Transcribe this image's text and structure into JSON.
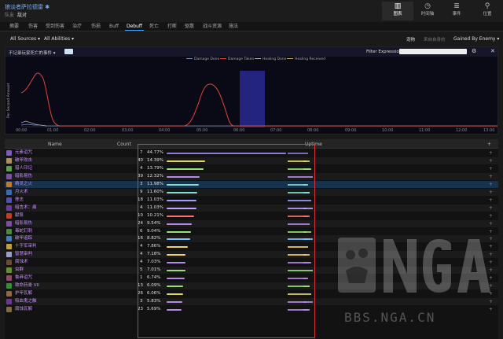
{
  "header": {
    "title": "狼淡者萨拉德雷",
    "title_icon": "✱",
    "subtitle_label": "队友",
    "subtitle_value": "敌对",
    "nav": [
      {
        "icon": "▥",
        "label": "图表"
      },
      {
        "icon": "◷",
        "label": "时间轴"
      },
      {
        "icon": "≣",
        "label": "事件"
      },
      {
        "icon": "⚲",
        "label": "位置"
      }
    ]
  },
  "tabs": [
    "摘要",
    "伤害",
    "受到伤害",
    "治疗",
    "伤损",
    "Buff",
    "Debuff",
    "死亡",
    "打断",
    "驱散",
    "战斗资源",
    "施法"
  ],
  "active_tab": "Debuff",
  "filters": {
    "sources": "All Sources ▾",
    "abilities": "All Abilities ▾",
    "right1": "宠物",
    "right2": "来自自身的",
    "gained_by": "Gained By Enemy ▾"
  },
  "chart": {
    "events_label": "不记录玩家死亡的事件 ▾",
    "filter_label": "Filter Expression",
    "filter_placeholder": "",
    "gear_icon": "⚙",
    "close_icon": "✕",
    "legend": [
      {
        "name": "Damage Done",
        "color": "#7d8cc4"
      },
      {
        "name": "Damage Taken",
        "color": "#e0453a"
      },
      {
        "name": "Healing Done",
        "color": "#b0b0b0"
      },
      {
        "name": "Healing Received",
        "color": "#c0a060"
      }
    ],
    "ylabel": "Per Second Amount",
    "xticks": [
      "00:00",
      "01:00",
      "02:00",
      "03:00",
      "04:00",
      "05:00",
      "06:00",
      "07:00",
      "08:00",
      "09:00",
      "10:00",
      "11:00",
      "12:00",
      "13:00"
    ]
  },
  "table": {
    "headers": {
      "name": "Name",
      "count": "Count",
      "uptime": "Uptime",
      "plus": "+"
    },
    "rows": [
      {
        "name": "元素诅咒",
        "count": "7",
        "pct": "44.77%",
        "uptime": 0.4477,
        "color": "#8e7dd6",
        "icon": "#7d5bbf"
      },
      {
        "name": "破甲攻击",
        "count": "40",
        "pct": "14.39%",
        "uptime": 0.1439,
        "color": "#e6d36a",
        "icon": "#b0905a"
      },
      {
        "name": "猎人印记",
        "count": "4",
        "pct": "13.79%",
        "uptime": 0.1379,
        "color": "#9adf7a",
        "icon": "#5aa04a"
      },
      {
        "name": "暗影易伤",
        "count": "39",
        "pct": "12.32%",
        "uptime": 0.1232,
        "color": "#b48ae6",
        "icon": "#7a50a0"
      },
      {
        "name": "精灵之火",
        "count": "3",
        "pct": "11.98%",
        "uptime": 0.1198,
        "color": "#7fe0d0",
        "icon": "#c07a30"
      },
      {
        "name": "月火术",
        "count": "9",
        "pct": "11.60%",
        "uptime": 0.116,
        "color": "#7fe0d0",
        "icon": "#3a6ab0"
      },
      {
        "name": "挫志",
        "count": "18",
        "pct": "11.03%",
        "uptime": 0.1103,
        "color": "#a0a0ff",
        "icon": "#5050b0"
      },
      {
        "name": "暗言术：痛",
        "count": "4",
        "pct": "11.03%",
        "uptime": 0.1103,
        "color": "#c8a0ff",
        "icon": "#6a3a9a"
      },
      {
        "name": "献祭",
        "count": "10",
        "pct": "10.21%",
        "uptime": 0.1021,
        "color": "#ff7070",
        "icon": "#c04020"
      },
      {
        "name": "暗影易伤",
        "count": "24",
        "pct": "9.54%",
        "uptime": 0.0954,
        "color": "#b48ae6",
        "icon": "#7a50a0"
      },
      {
        "name": "毒蛇钉刺",
        "count": "6",
        "pct": "9.04%",
        "uptime": 0.0904,
        "color": "#9adf7a",
        "icon": "#4a8a3a"
      },
      {
        "name": "破甲追踪",
        "count": "16",
        "pct": "8.82%",
        "uptime": 0.0882,
        "color": "#7fc0ff",
        "icon": "#4a7ab0"
      },
      {
        "name": "十字军审判",
        "count": "4",
        "pct": "7.86%",
        "uptime": 0.0786,
        "color": "#f0d070",
        "icon": "#c0a040"
      },
      {
        "name": "智慧审判",
        "count": "4",
        "pct": "7.18%",
        "uptime": 0.0718,
        "color": "#f0d070",
        "icon": "#9aa0c0"
      },
      {
        "name": "腐蚀术",
        "count": "4",
        "pct": "7.03%",
        "uptime": 0.0703,
        "color": "#b48ae6",
        "icon": "#6a4a3a"
      },
      {
        "name": "虫群",
        "count": "5",
        "pct": "7.01%",
        "uptime": 0.0701,
        "color": "#9adf7a",
        "icon": "#6a8a3a"
      },
      {
        "name": "鲁莽诅咒",
        "count": "1",
        "pct": "6.74%",
        "uptime": 0.0674,
        "color": "#b48ae6",
        "icon": "#8a4a6a"
      },
      {
        "name": "致命药膏 VII",
        "count": "13",
        "pct": "6.09%",
        "uptime": 0.0609,
        "color": "#9adf7a",
        "icon": "#3a8a3a"
      },
      {
        "name": "护甲瓦解",
        "count": "26",
        "pct": "6.06%",
        "uptime": 0.0606,
        "color": "#e6d36a",
        "icon": "#8a6a4a"
      },
      {
        "name": "吸血鬼之触",
        "count": "3",
        "pct": "5.83%",
        "uptime": 0.0583,
        "color": "#b48ae6",
        "icon": "#6a3a8a"
      },
      {
        "name": "腐蚀瓦解",
        "count": "23",
        "pct": "5.69%",
        "uptime": 0.0569,
        "color": "#b48ae6",
        "icon": "#7a6a4a"
      }
    ]
  },
  "watermark": {
    "text": "NGA",
    "url": "BBS.NGA.CN"
  }
}
